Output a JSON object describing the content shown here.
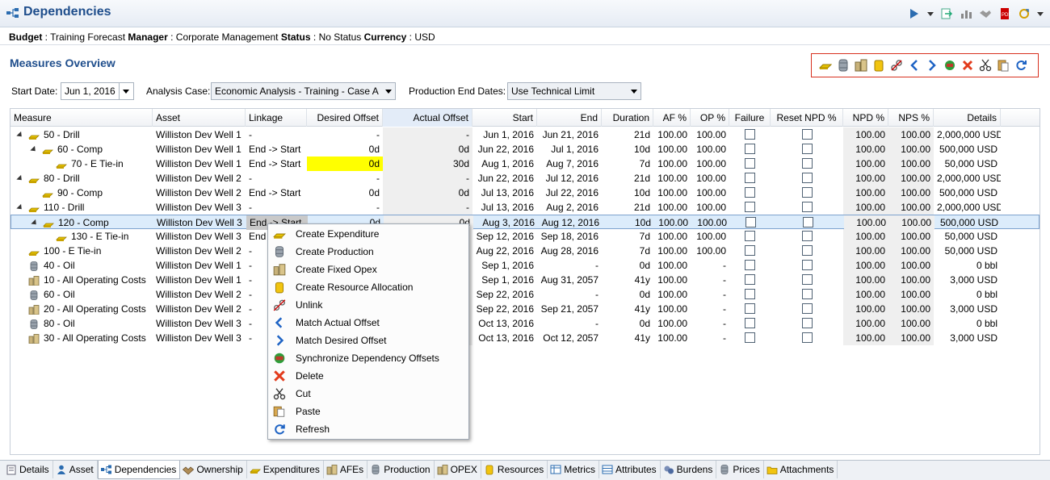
{
  "window": {
    "title": "Dependencies"
  },
  "info": {
    "budget_label": "Budget",
    "budget_value": "Training Forecast",
    "manager_label": "Manager",
    "manager_value": "Corporate Management",
    "status_label": "Status",
    "status_value": "No Status",
    "currency_label": "Currency",
    "currency_value": "USD"
  },
  "section": {
    "title": "Measures Overview"
  },
  "params": {
    "start_date_label": "Start Date:",
    "start_date_value": "Jun 1, 2016",
    "analysis_case_label": "Analysis Case:",
    "analysis_case_value": "Economic Analysis - Training - Case A",
    "production_end_label": "Production End Dates:",
    "production_end_value": "Use Technical Limit"
  },
  "columns": [
    "Measure",
    "Asset",
    "Linkage",
    "Desired Offset",
    "Actual Offset",
    "Start",
    "End",
    "Duration",
    "AF %",
    "OP %",
    "Failure",
    "Reset NPD %",
    "NPD %",
    "NPS %",
    "Details"
  ],
  "rows": [
    {
      "level": 0,
      "expand": true,
      "icon": "gold-bar-icon",
      "measure": "50 - Drill",
      "asset": "Williston Dev Well 1",
      "linkage": "-",
      "desired": "-",
      "actual": "-",
      "start": "Jun 1, 2016",
      "end": "Jun 21, 2016",
      "duration": "21d",
      "af": "100.00",
      "op": "100.00",
      "npd": "100.00",
      "nps": "100.00",
      "details": "2,000,000 USD"
    },
    {
      "level": 1,
      "expand": true,
      "icon": "gold-bar-icon",
      "measure": "60 - Comp",
      "asset": "Williston Dev Well 1",
      "linkage": "End -> Start",
      "desired": "0d",
      "actual": "0d",
      "start": "Jun 22, 2016",
      "end": "Jul 1, 2016",
      "duration": "10d",
      "af": "100.00",
      "op": "100.00",
      "npd": "100.00",
      "nps": "100.00",
      "details": "500,000 USD"
    },
    {
      "level": 2,
      "expand": false,
      "icon": "gold-bar-icon",
      "measure": "70 - E Tie-in",
      "asset": "Williston Dev Well 1",
      "linkage": "End -> Start",
      "desired": "0d",
      "actual": "30d",
      "start": "Aug 1, 2016",
      "end": "Aug 7, 2016",
      "duration": "7d",
      "af": "100.00",
      "op": "100.00",
      "npd": "100.00",
      "nps": "100.00",
      "details": "50,000 USD",
      "highlight_desired": true
    },
    {
      "level": 0,
      "expand": true,
      "icon": "gold-bar-icon",
      "measure": "80 - Drill",
      "asset": "Williston Dev Well 2",
      "linkage": "-",
      "desired": "-",
      "actual": "-",
      "start": "Jun 22, 2016",
      "end": "Jul 12, 2016",
      "duration": "21d",
      "af": "100.00",
      "op": "100.00",
      "npd": "100.00",
      "nps": "100.00",
      "details": "2,000,000 USD"
    },
    {
      "level": 1,
      "expand": false,
      "icon": "gold-bar-icon",
      "measure": "90 - Comp",
      "asset": "Williston Dev Well 2",
      "linkage": "End -> Start",
      "desired": "0d",
      "actual": "0d",
      "start": "Jul 13, 2016",
      "end": "Jul 22, 2016",
      "duration": "10d",
      "af": "100.00",
      "op": "100.00",
      "npd": "100.00",
      "nps": "100.00",
      "details": "500,000 USD"
    },
    {
      "level": 0,
      "expand": true,
      "icon": "gold-bar-icon",
      "measure": "110 - Drill",
      "asset": "Williston Dev Well 3",
      "linkage": "-",
      "desired": "-",
      "actual": "-",
      "start": "Jul 13, 2016",
      "end": "Aug 2, 2016",
      "duration": "21d",
      "af": "100.00",
      "op": "100.00",
      "npd": "100.00",
      "nps": "100.00",
      "details": "2,000,000 USD"
    },
    {
      "level": 1,
      "expand": true,
      "icon": "gold-bar-icon",
      "measure": "120 - Comp",
      "asset": "Williston Dev Well 3",
      "linkage": "End -> Start",
      "desired": "0d",
      "actual": "0d",
      "start": "Aug 3, 2016",
      "end": "Aug 12, 2016",
      "duration": "10d",
      "af": "100.00",
      "op": "100.00",
      "npd": "100.00",
      "nps": "100.00",
      "details": "500,000 USD",
      "selected": true
    },
    {
      "level": 2,
      "expand": false,
      "icon": "gold-bar-icon",
      "measure": "130 - E Tie-in",
      "asset": "Williston Dev Well 3",
      "linkage": "End -> Start",
      "desired": "",
      "actual": "",
      "start": "Sep 12, 2016",
      "end": "Sep 18, 2016",
      "duration": "7d",
      "af": "100.00",
      "op": "100.00",
      "npd": "100.00",
      "nps": "100.00",
      "details": "50,000 USD"
    },
    {
      "level": 0,
      "expand": false,
      "icon": "gold-bar-icon",
      "measure": "100 - E Tie-in",
      "asset": "Williston Dev Well 2",
      "linkage": "-",
      "desired": "",
      "actual": "",
      "start": "Aug 22, 2016",
      "end": "Aug 28, 2016",
      "duration": "7d",
      "af": "100.00",
      "op": "100.00",
      "npd": "100.00",
      "nps": "100.00",
      "details": "50,000 USD"
    },
    {
      "level": 0,
      "expand": false,
      "icon": "oil-barrel-icon",
      "measure": "40 - Oil",
      "asset": "Williston Dev Well 1",
      "linkage": "-",
      "desired": "",
      "actual": "",
      "start": "Sep 1, 2016",
      "end": "-",
      "duration": "0d",
      "af": "100.00",
      "op": "-",
      "npd": "100.00",
      "nps": "100.00",
      "details": "0 bbl"
    },
    {
      "level": 0,
      "expand": false,
      "icon": "operating-costs-icon",
      "measure": "10 - All Operating Costs",
      "asset": "Williston Dev Well 1",
      "linkage": "-",
      "desired": "",
      "actual": "",
      "start": "Sep 1, 2016",
      "end": "Aug 31, 2057",
      "duration": "41y",
      "af": "100.00",
      "op": "-",
      "npd": "100.00",
      "nps": "100.00",
      "details": "3,000 USD"
    },
    {
      "level": 0,
      "expand": false,
      "icon": "oil-barrel-icon",
      "measure": "60 - Oil",
      "asset": "Williston Dev Well 2",
      "linkage": "-",
      "desired": "",
      "actual": "",
      "start": "Sep 22, 2016",
      "end": "-",
      "duration": "0d",
      "af": "100.00",
      "op": "-",
      "npd": "100.00",
      "nps": "100.00",
      "details": "0 bbl"
    },
    {
      "level": 0,
      "expand": false,
      "icon": "operating-costs-icon",
      "measure": "20 - All Operating Costs",
      "asset": "Williston Dev Well 2",
      "linkage": "-",
      "desired": "",
      "actual": "",
      "start": "Sep 22, 2016",
      "end": "Sep 21, 2057",
      "duration": "41y",
      "af": "100.00",
      "op": "-",
      "npd": "100.00",
      "nps": "100.00",
      "details": "3,000 USD"
    },
    {
      "level": 0,
      "expand": false,
      "icon": "oil-barrel-icon",
      "measure": "80 - Oil",
      "asset": "Williston Dev Well 3",
      "linkage": "-",
      "desired": "",
      "actual": "",
      "start": "Oct 13, 2016",
      "end": "-",
      "duration": "0d",
      "af": "100.00",
      "op": "-",
      "npd": "100.00",
      "nps": "100.00",
      "details": "0 bbl"
    },
    {
      "level": 0,
      "expand": false,
      "icon": "operating-costs-icon",
      "measure": "30 - All Operating Costs",
      "asset": "Williston Dev Well 3",
      "linkage": "-",
      "desired": "",
      "actual": "",
      "start": "Oct 13, 2016",
      "end": "Oct 12, 2057",
      "duration": "41y",
      "af": "100.00",
      "op": "-",
      "npd": "100.00",
      "nps": "100.00",
      "details": "3,000 USD"
    }
  ],
  "context_menu": [
    {
      "label": "Create Expenditure",
      "icon": "gold-bar-icon"
    },
    {
      "label": "Create Production",
      "icon": "oil-barrel-icon"
    },
    {
      "label": "Create Fixed Opex",
      "icon": "operating-costs-icon"
    },
    {
      "label": "Create Resource Allocation",
      "icon": "resource-jar-icon"
    },
    {
      "label": "Unlink",
      "icon": "unlink-icon"
    },
    {
      "label": "Match Actual Offset",
      "icon": "arrow-left-icon"
    },
    {
      "label": "Match Desired Offset",
      "icon": "arrow-right-icon"
    },
    {
      "label": "Synchronize Dependency Offsets",
      "icon": "synchronize-icon"
    },
    {
      "label": "Delete",
      "icon": "delete-icon"
    },
    {
      "label": "Cut",
      "icon": "scissors-icon"
    },
    {
      "label": "Paste",
      "icon": "paste-icon"
    },
    {
      "label": "Refresh",
      "icon": "refresh-icon"
    }
  ],
  "tabs": [
    {
      "label": "Details",
      "icon": "details-icon"
    },
    {
      "label": "Asset",
      "icon": "person-icon"
    },
    {
      "label": "Dependencies",
      "icon": "dependencies-icon",
      "active": true
    },
    {
      "label": "Ownership",
      "icon": "handshake-icon"
    },
    {
      "label": "Expenditures",
      "icon": "gold-bar-icon"
    },
    {
      "label": "AFEs",
      "icon": "operating-costs-icon"
    },
    {
      "label": "Production",
      "icon": "oil-barrel-icon"
    },
    {
      "label": "OPEX",
      "icon": "operating-costs-icon"
    },
    {
      "label": "Resources",
      "icon": "resource-jar-icon"
    },
    {
      "label": "Metrics",
      "icon": "metrics-icon"
    },
    {
      "label": "Attributes",
      "icon": "attributes-icon"
    },
    {
      "label": "Burdens",
      "icon": "burdens-icon"
    },
    {
      "label": "Prices",
      "icon": "oil-barrel-icon"
    },
    {
      "label": "Attachments",
      "icon": "folder-icon"
    }
  ],
  "colors": {
    "accent": "#1f4e8c",
    "highlight": "#ffff00",
    "frame": "#d8301f"
  }
}
